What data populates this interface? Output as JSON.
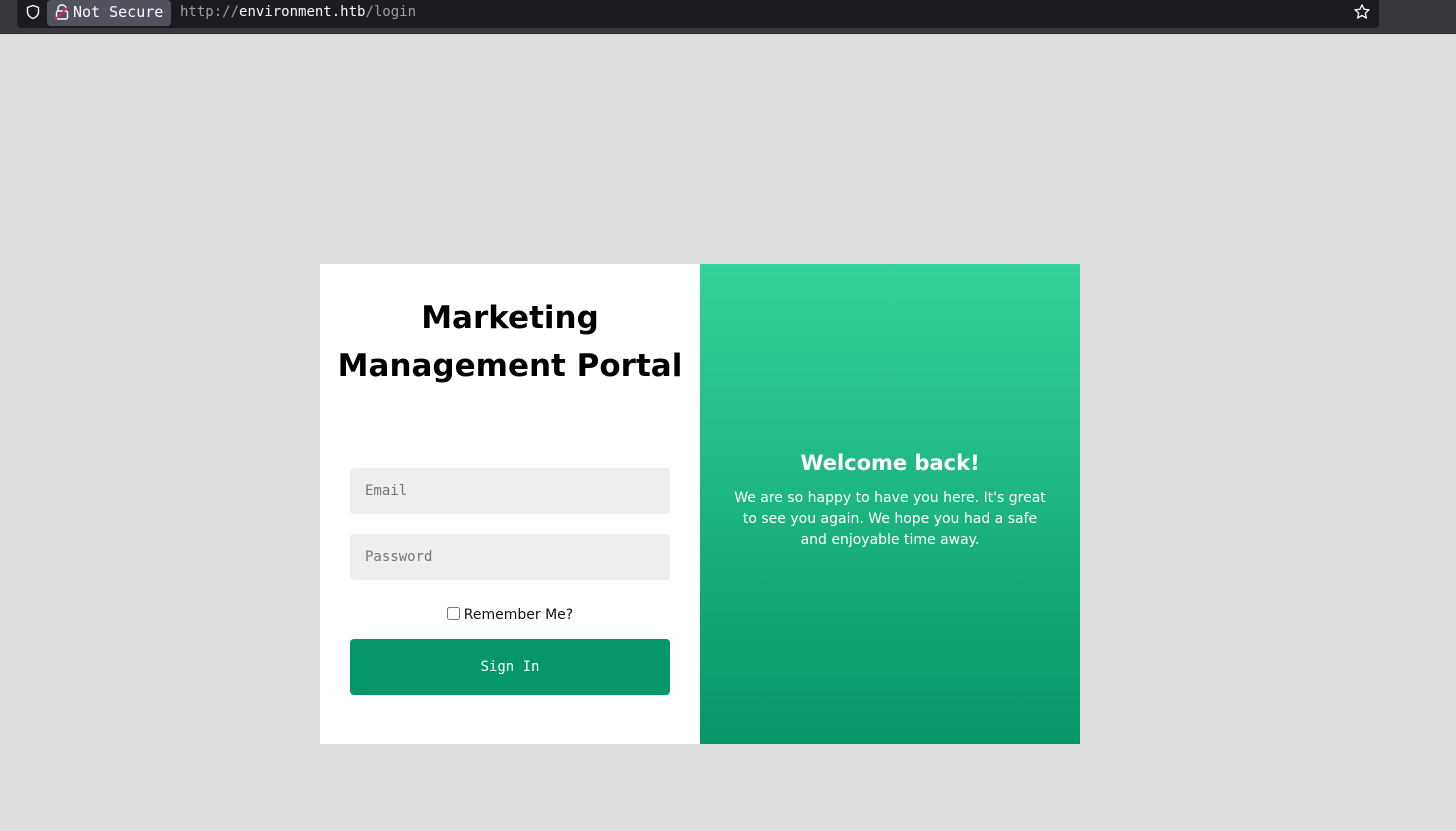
{
  "browser": {
    "security_label": "Not Secure",
    "url_scheme": "http://",
    "url_host": "environment.htb",
    "url_path": "/login",
    "icons": {
      "shield": "shield-icon",
      "lock": "broken-lock-icon",
      "bookmark": "star-icon"
    }
  },
  "login": {
    "title": "Marketing Management Portal",
    "email_placeholder": "Email",
    "email_value": "",
    "password_placeholder": "Password",
    "password_value": "",
    "remember_label": "Remember Me?",
    "remember_checked": false,
    "submit_label": "Sign In"
  },
  "welcome": {
    "title": "Welcome back!",
    "text": "We are so happy to have you here. It's great to see you again. We hope you had a safe and enjoyable time away."
  },
  "colors": {
    "page_background": "#dddddd",
    "accent": "#059669",
    "gradient_start": "#34d399",
    "gradient_end": "#059669",
    "input_background": "#eeeeee"
  }
}
